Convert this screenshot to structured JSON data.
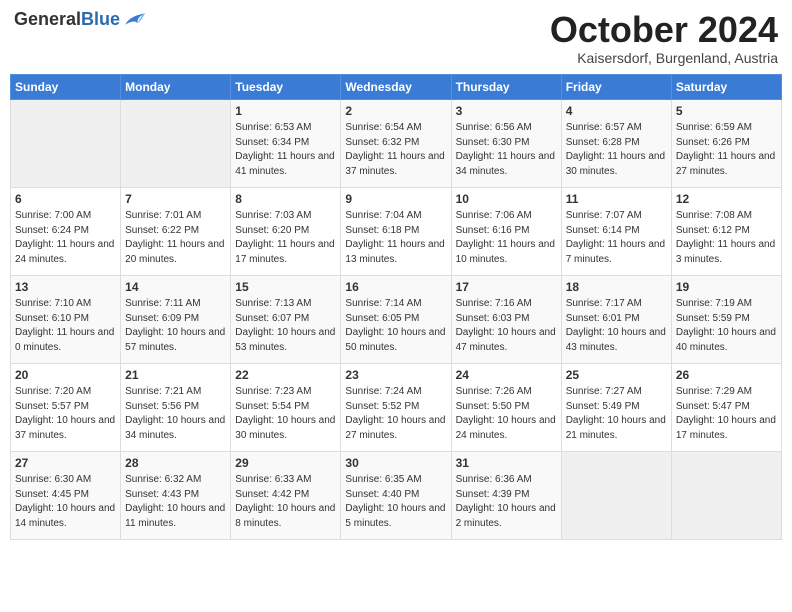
{
  "header": {
    "logo_general": "General",
    "logo_blue": "Blue",
    "month_title": "October 2024",
    "subtitle": "Kaisersdorf, Burgenland, Austria"
  },
  "calendar": {
    "weekdays": [
      "Sunday",
      "Monday",
      "Tuesday",
      "Wednesday",
      "Thursday",
      "Friday",
      "Saturday"
    ],
    "weeks": [
      [
        {
          "day": "",
          "detail": ""
        },
        {
          "day": "",
          "detail": ""
        },
        {
          "day": "1",
          "detail": "Sunrise: 6:53 AM\nSunset: 6:34 PM\nDaylight: 11 hours and 41 minutes."
        },
        {
          "day": "2",
          "detail": "Sunrise: 6:54 AM\nSunset: 6:32 PM\nDaylight: 11 hours and 37 minutes."
        },
        {
          "day": "3",
          "detail": "Sunrise: 6:56 AM\nSunset: 6:30 PM\nDaylight: 11 hours and 34 minutes."
        },
        {
          "day": "4",
          "detail": "Sunrise: 6:57 AM\nSunset: 6:28 PM\nDaylight: 11 hours and 30 minutes."
        },
        {
          "day": "5",
          "detail": "Sunrise: 6:59 AM\nSunset: 6:26 PM\nDaylight: 11 hours and 27 minutes."
        }
      ],
      [
        {
          "day": "6",
          "detail": "Sunrise: 7:00 AM\nSunset: 6:24 PM\nDaylight: 11 hours and 24 minutes."
        },
        {
          "day": "7",
          "detail": "Sunrise: 7:01 AM\nSunset: 6:22 PM\nDaylight: 11 hours and 20 minutes."
        },
        {
          "day": "8",
          "detail": "Sunrise: 7:03 AM\nSunset: 6:20 PM\nDaylight: 11 hours and 17 minutes."
        },
        {
          "day": "9",
          "detail": "Sunrise: 7:04 AM\nSunset: 6:18 PM\nDaylight: 11 hours and 13 minutes."
        },
        {
          "day": "10",
          "detail": "Sunrise: 7:06 AM\nSunset: 6:16 PM\nDaylight: 11 hours and 10 minutes."
        },
        {
          "day": "11",
          "detail": "Sunrise: 7:07 AM\nSunset: 6:14 PM\nDaylight: 11 hours and 7 minutes."
        },
        {
          "day": "12",
          "detail": "Sunrise: 7:08 AM\nSunset: 6:12 PM\nDaylight: 11 hours and 3 minutes."
        }
      ],
      [
        {
          "day": "13",
          "detail": "Sunrise: 7:10 AM\nSunset: 6:10 PM\nDaylight: 11 hours and 0 minutes."
        },
        {
          "day": "14",
          "detail": "Sunrise: 7:11 AM\nSunset: 6:09 PM\nDaylight: 10 hours and 57 minutes."
        },
        {
          "day": "15",
          "detail": "Sunrise: 7:13 AM\nSunset: 6:07 PM\nDaylight: 10 hours and 53 minutes."
        },
        {
          "day": "16",
          "detail": "Sunrise: 7:14 AM\nSunset: 6:05 PM\nDaylight: 10 hours and 50 minutes."
        },
        {
          "day": "17",
          "detail": "Sunrise: 7:16 AM\nSunset: 6:03 PM\nDaylight: 10 hours and 47 minutes."
        },
        {
          "day": "18",
          "detail": "Sunrise: 7:17 AM\nSunset: 6:01 PM\nDaylight: 10 hours and 43 minutes."
        },
        {
          "day": "19",
          "detail": "Sunrise: 7:19 AM\nSunset: 5:59 PM\nDaylight: 10 hours and 40 minutes."
        }
      ],
      [
        {
          "day": "20",
          "detail": "Sunrise: 7:20 AM\nSunset: 5:57 PM\nDaylight: 10 hours and 37 minutes."
        },
        {
          "day": "21",
          "detail": "Sunrise: 7:21 AM\nSunset: 5:56 PM\nDaylight: 10 hours and 34 minutes."
        },
        {
          "day": "22",
          "detail": "Sunrise: 7:23 AM\nSunset: 5:54 PM\nDaylight: 10 hours and 30 minutes."
        },
        {
          "day": "23",
          "detail": "Sunrise: 7:24 AM\nSunset: 5:52 PM\nDaylight: 10 hours and 27 minutes."
        },
        {
          "day": "24",
          "detail": "Sunrise: 7:26 AM\nSunset: 5:50 PM\nDaylight: 10 hours and 24 minutes."
        },
        {
          "day": "25",
          "detail": "Sunrise: 7:27 AM\nSunset: 5:49 PM\nDaylight: 10 hours and 21 minutes."
        },
        {
          "day": "26",
          "detail": "Sunrise: 7:29 AM\nSunset: 5:47 PM\nDaylight: 10 hours and 17 minutes."
        }
      ],
      [
        {
          "day": "27",
          "detail": "Sunrise: 6:30 AM\nSunset: 4:45 PM\nDaylight: 10 hours and 14 minutes."
        },
        {
          "day": "28",
          "detail": "Sunrise: 6:32 AM\nSunset: 4:43 PM\nDaylight: 10 hours and 11 minutes."
        },
        {
          "day": "29",
          "detail": "Sunrise: 6:33 AM\nSunset: 4:42 PM\nDaylight: 10 hours and 8 minutes."
        },
        {
          "day": "30",
          "detail": "Sunrise: 6:35 AM\nSunset: 4:40 PM\nDaylight: 10 hours and 5 minutes."
        },
        {
          "day": "31",
          "detail": "Sunrise: 6:36 AM\nSunset: 4:39 PM\nDaylight: 10 hours and 2 minutes."
        },
        {
          "day": "",
          "detail": ""
        },
        {
          "day": "",
          "detail": ""
        }
      ]
    ]
  }
}
